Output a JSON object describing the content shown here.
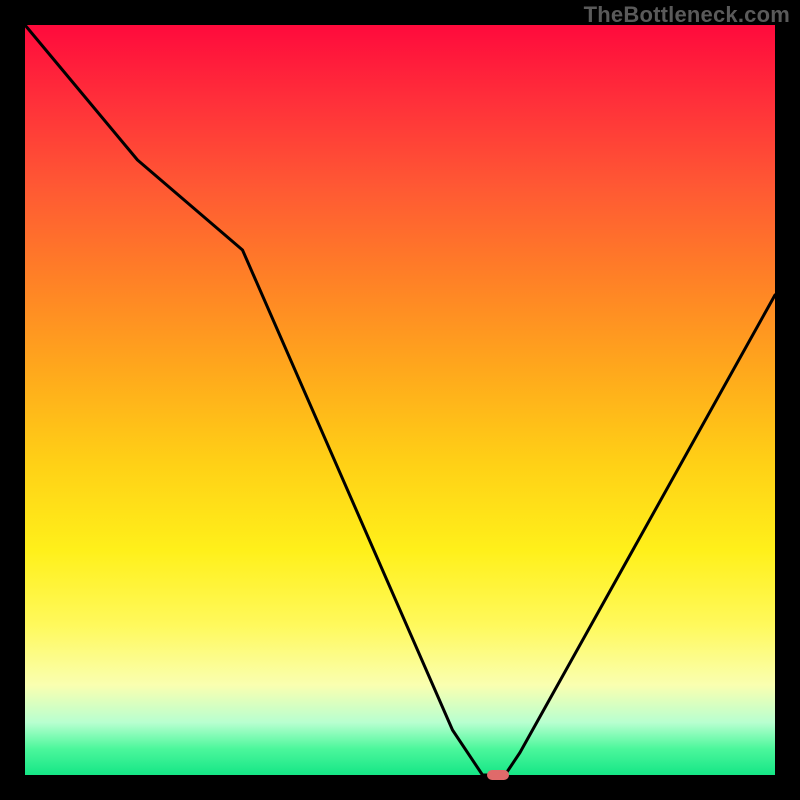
{
  "watermark": "TheBottleneck.com",
  "chart_data": {
    "type": "line",
    "title": "",
    "xlabel": "",
    "ylabel": "",
    "xlim": [
      0,
      100
    ],
    "ylim": [
      0,
      100
    ],
    "background_gradient": {
      "top": "#ff0a3c",
      "bottom": "#15e686",
      "stops": [
        "#ff0a3c",
        "#ff5a33",
        "#ffa81c",
        "#fff01a",
        "#faffb0",
        "#4cf79c",
        "#15e686"
      ]
    },
    "series": [
      {
        "name": "bottleneck-curve",
        "x": [
          0,
          5,
          15,
          29,
          57,
          61,
          64,
          66,
          100
        ],
        "values": [
          100,
          94,
          82,
          70,
          6,
          0,
          0,
          3,
          64
        ]
      }
    ],
    "marker": {
      "name": "optimal-point",
      "x": 63,
      "y": 0,
      "color": "#e06a6a"
    }
  }
}
